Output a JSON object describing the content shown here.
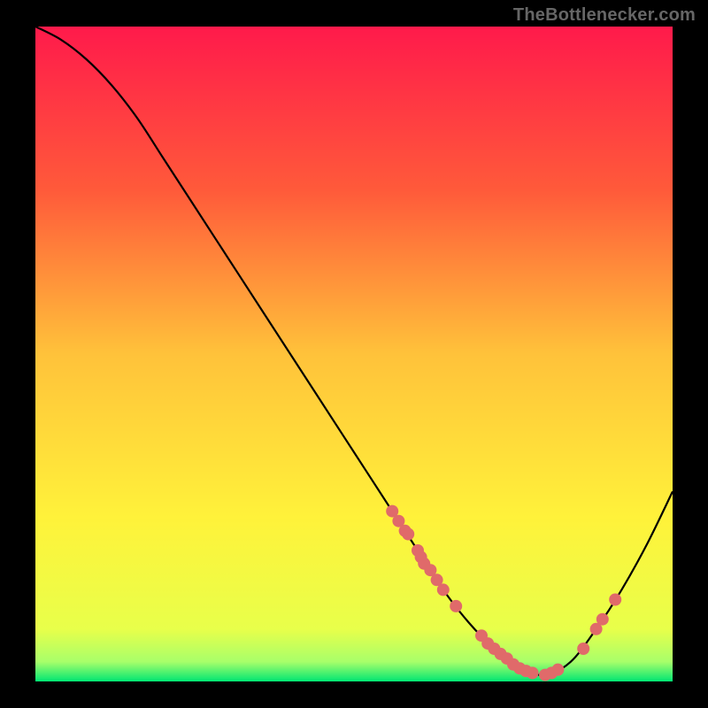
{
  "attribution": "TheBottlenecker.com",
  "chart_data": {
    "type": "line",
    "title": "",
    "xlabel": "",
    "ylabel": "",
    "xlim": [
      0,
      100
    ],
    "ylim": [
      0,
      100
    ],
    "gradient_stops": [
      {
        "offset": 0,
        "color": "#ff1a4b"
      },
      {
        "offset": 25,
        "color": "#ff5a3a"
      },
      {
        "offset": 50,
        "color": "#ffc23a"
      },
      {
        "offset": 75,
        "color": "#fff23a"
      },
      {
        "offset": 92,
        "color": "#e8ff4a"
      },
      {
        "offset": 97,
        "color": "#a8ff6a"
      },
      {
        "offset": 100,
        "color": "#00e673"
      }
    ],
    "series": [
      {
        "name": "bottleneck-curve",
        "color": "#000000",
        "x": [
          0,
          4,
          8,
          12,
          16,
          20,
          24,
          28,
          32,
          36,
          40,
          44,
          48,
          52,
          56,
          60,
          64,
          68,
          72,
          76,
          80,
          84,
          88,
          92,
          96,
          100
        ],
        "y": [
          100,
          98,
          95,
          91,
          86,
          80,
          74,
          68,
          62,
          56,
          50,
          44,
          38,
          32,
          26,
          20,
          14,
          9,
          5,
          2,
          1,
          3,
          8,
          14,
          21,
          29
        ]
      }
    ],
    "markers": {
      "name": "sample-points",
      "color": "#e06a6a",
      "radius": 7,
      "points": [
        {
          "x": 56,
          "y": 26
        },
        {
          "x": 57,
          "y": 24.5
        },
        {
          "x": 58,
          "y": 23
        },
        {
          "x": 58.5,
          "y": 22.5
        },
        {
          "x": 60,
          "y": 20
        },
        {
          "x": 60.5,
          "y": 19
        },
        {
          "x": 61,
          "y": 18
        },
        {
          "x": 62,
          "y": 17
        },
        {
          "x": 63,
          "y": 15.5
        },
        {
          "x": 64,
          "y": 14
        },
        {
          "x": 66,
          "y": 11.5
        },
        {
          "x": 70,
          "y": 7
        },
        {
          "x": 71,
          "y": 5.8
        },
        {
          "x": 72,
          "y": 5
        },
        {
          "x": 73,
          "y": 4.2
        },
        {
          "x": 74,
          "y": 3.5
        },
        {
          "x": 75,
          "y": 2.6
        },
        {
          "x": 76,
          "y": 2
        },
        {
          "x": 77,
          "y": 1.6
        },
        {
          "x": 78,
          "y": 1.3
        },
        {
          "x": 80,
          "y": 1
        },
        {
          "x": 81,
          "y": 1.3
        },
        {
          "x": 82,
          "y": 1.8
        },
        {
          "x": 86,
          "y": 5
        },
        {
          "x": 88,
          "y": 8
        },
        {
          "x": 89,
          "y": 9.5
        },
        {
          "x": 91,
          "y": 12.5
        }
      ]
    }
  }
}
